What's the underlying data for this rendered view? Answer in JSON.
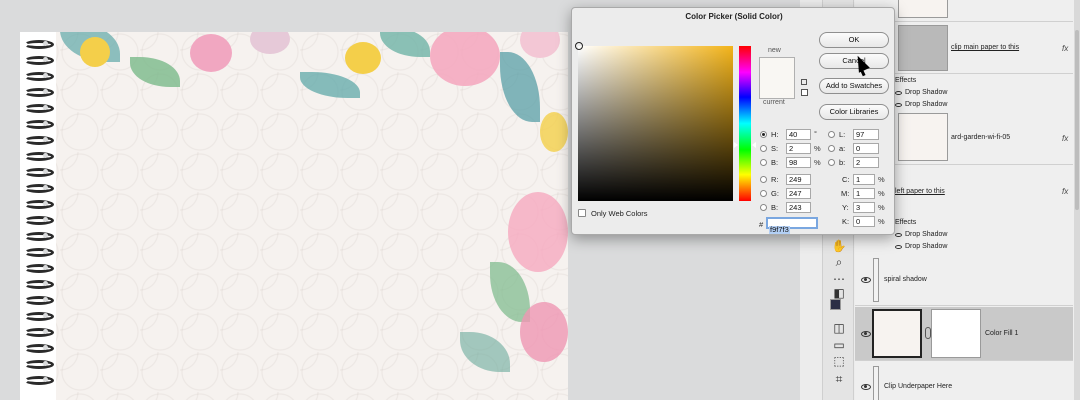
{
  "dialog": {
    "title": "Color Picker (Solid Color)",
    "ok_label": "OK",
    "cancel_label": "Cancel",
    "add_swatches_label": "Add to Swatches",
    "color_libraries_label": "Color Libraries",
    "new_label": "new",
    "current_label": "current",
    "only_web_colors_label": "Only Web Colors",
    "hsb": {
      "h_label": "H:",
      "h_value": "40",
      "h_unit": "°",
      "s_label": "S:",
      "s_value": "2",
      "s_unit": "%",
      "b_label": "B:",
      "b_value": "98",
      "b_unit": "%"
    },
    "rgb": {
      "r_label": "R:",
      "r_value": "249",
      "g_label": "G:",
      "g_value": "247",
      "b_label": "B:",
      "b_value": "243"
    },
    "lab": {
      "l_label": "L:",
      "l_value": "97",
      "a_label": "a:",
      "a_value": "0",
      "b_label": "b:",
      "b_value": "2"
    },
    "cmyk": {
      "c_label": "C:",
      "c_value": "1",
      "c_unit": "%",
      "m_label": "M:",
      "m_value": "1",
      "m_unit": "%",
      "y_label": "Y:",
      "y_value": "3",
      "y_unit": "%",
      "k_label": "K:",
      "k_value": "0",
      "k_unit": "%"
    },
    "hex_prefix": "#",
    "hex_value": "f9f7f3",
    "selected_color": "#f9f7f3",
    "base_hue_color": "#f3b41a"
  },
  "layers": {
    "clip_main_paper": "clip main paper to this",
    "effects_label": "Effects",
    "drop_shadow_1": "Drop Shadow",
    "drop_shadow_2": "Drop Shadow",
    "garden_layer": "ard-garden-wi-fi-05",
    "left_paper": "left paper to this",
    "effects_label_2": "Effects",
    "drop_shadow_3": "Drop Shadow",
    "drop_shadow_4": "Drop Shadow",
    "spiral_shadow": "spiral shadow",
    "color_fill": "Color Fill 1",
    "clip_underpaper": "Clip Underpaper Here",
    "fx_label": "fx"
  }
}
